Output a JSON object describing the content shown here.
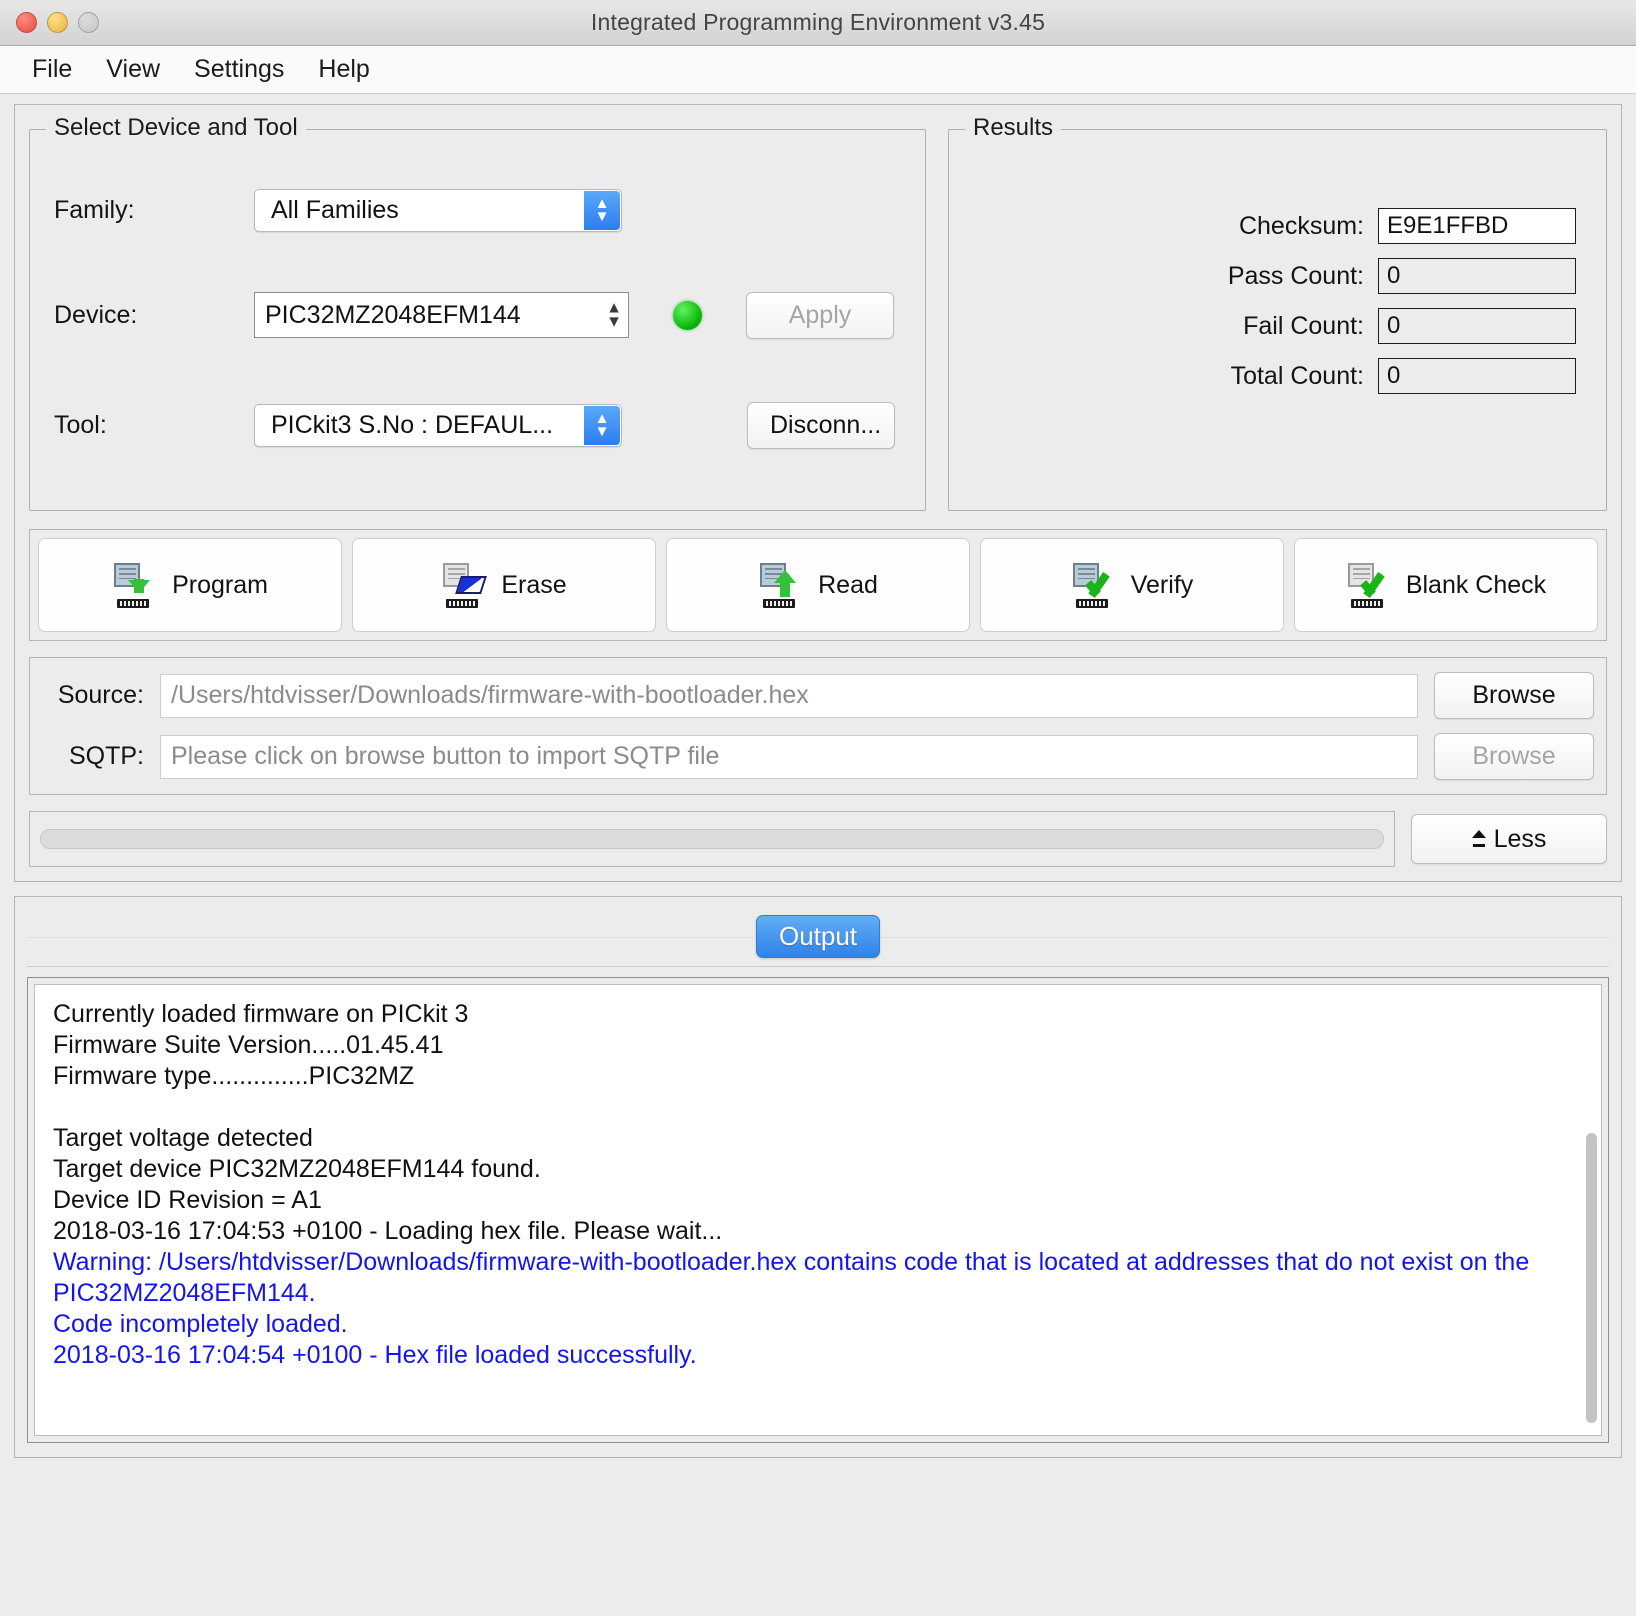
{
  "window": {
    "title": "Integrated Programming Environment v3.45",
    "traffic_lights": [
      "close",
      "minimize",
      "zoom"
    ]
  },
  "menubar": {
    "items": [
      {
        "label": "File"
      },
      {
        "label": "View"
      },
      {
        "label": "Settings"
      },
      {
        "label": "Help"
      }
    ]
  },
  "device_group": {
    "title": "Select Device and Tool",
    "family": {
      "label": "Family:",
      "value": "All Families"
    },
    "device": {
      "label": "Device:",
      "value": "PIC32MZ2048EFM144"
    },
    "tool": {
      "label": "Tool:",
      "value": "PICkit3 S.No : DEFAUL..."
    },
    "status_led": {
      "name": "connected-led",
      "color": "#0bb60b"
    },
    "apply_button": {
      "label": "Apply",
      "enabled": false
    },
    "disconnect_button": {
      "label": "Disconn...",
      "enabled": true
    }
  },
  "results_group": {
    "title": "Results",
    "rows": [
      {
        "label": "Checksum:",
        "value": "E9E1FFBD",
        "editable": true
      },
      {
        "label": "Pass Count:",
        "value": "0",
        "editable": false
      },
      {
        "label": "Fail Count:",
        "value": "0",
        "editable": false
      },
      {
        "label": "Total Count:",
        "value": "0",
        "editable": false
      }
    ]
  },
  "actions": {
    "buttons": [
      {
        "label": "Program",
        "icon": "chip-download-icon"
      },
      {
        "label": "Erase",
        "icon": "chip-eraser-icon"
      },
      {
        "label": "Read",
        "icon": "chip-upload-icon"
      },
      {
        "label": "Verify",
        "icon": "chip-check-icon"
      },
      {
        "label": "Blank Check",
        "icon": "chip-blank-check-icon"
      }
    ]
  },
  "source_section": {
    "source": {
      "label": "Source:",
      "value": "/Users/htdvisser/Downloads/firmware-with-bootloader.hex",
      "browse_label": "Browse",
      "browse_enabled": true
    },
    "sqtp": {
      "label": "SQTP:",
      "placeholder": "Please click on browse button to import SQTP file",
      "value": "",
      "browse_label": "Browse",
      "browse_enabled": false
    }
  },
  "progress": {
    "percent": 0,
    "less_button": {
      "label": "Less",
      "icon": "collapse-icon"
    }
  },
  "output_panel": {
    "tabs": [
      {
        "label": "Output",
        "active": true
      }
    ],
    "console_lines": [
      {
        "text": "Currently loaded firmware on PICkit 3",
        "color": "black"
      },
      {
        "text": "Firmware Suite Version.....01.45.41",
        "color": "black"
      },
      {
        "text": "Firmware type..............PIC32MZ",
        "color": "black"
      },
      {
        "text": "",
        "color": "black"
      },
      {
        "text": "Target voltage detected",
        "color": "black"
      },
      {
        "text": "Target device PIC32MZ2048EFM144 found.",
        "color": "black"
      },
      {
        "text": "Device ID Revision = A1",
        "color": "black"
      },
      {
        "text": "2018-03-16 17:04:53 +0100 - Loading hex file. Please wait...",
        "color": "black"
      },
      {
        "text": "Warning: /Users/htdvisser/Downloads/firmware-with-bootloader.hex contains code that is located at addresses that do not exist on the PIC32MZ2048EFM144.",
        "color": "blue"
      },
      {
        "text": "Code incompletely loaded.",
        "color": "blue"
      },
      {
        "text": "2018-03-16 17:04:54 +0100 - Hex file loaded successfully.",
        "color": "blue"
      }
    ],
    "scrollbar": {
      "visible": true
    }
  },
  "colors": {
    "accent_blue": "#2f82ea",
    "warning_text": "#1414ee",
    "led_green": "#0bb60b",
    "window_bg": "#ececec"
  }
}
